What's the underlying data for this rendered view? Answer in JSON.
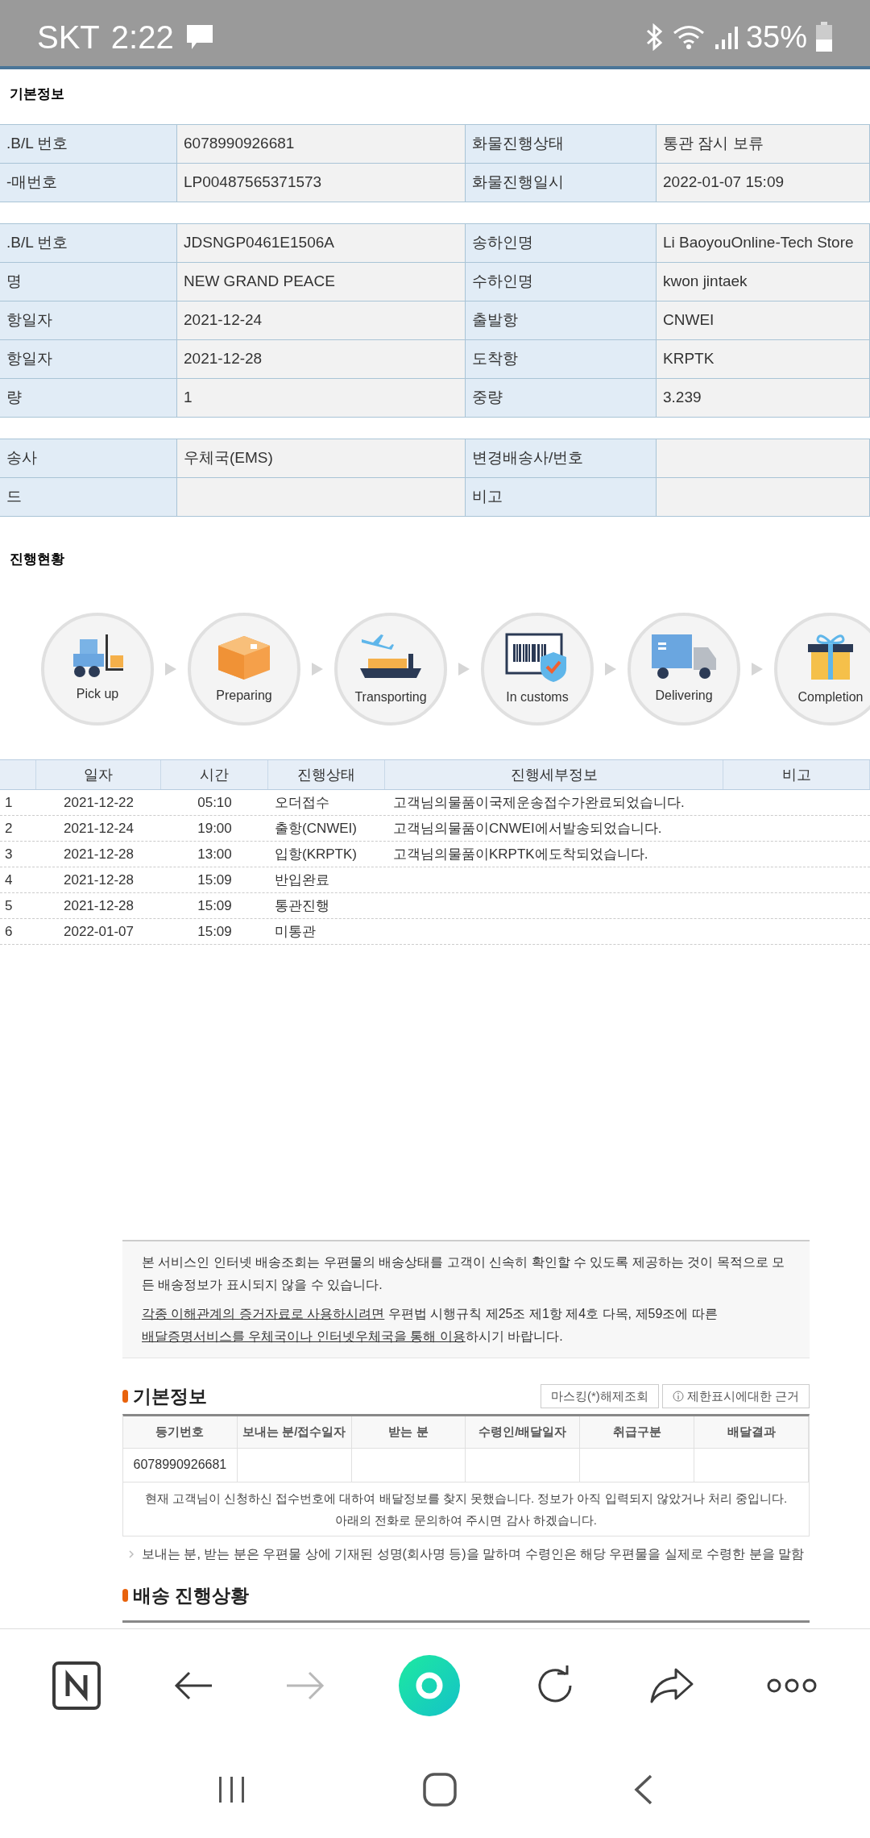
{
  "status_bar": {
    "carrier": "SKT",
    "time": "2:22",
    "battery": "35%"
  },
  "basic_info": {
    "title": "기본정보",
    "groups": [
      [
        {
          "label_1": ".B/L 번호",
          "value_1": "6078990926681",
          "label_2": "화물진행상태",
          "value_2": "통관 잠시 보류"
        },
        {
          "label_1": "-매번호",
          "value_1": "LP00487565371573",
          "label_2": "화물진행일시",
          "value_2": "2022-01-07 15:09"
        }
      ],
      [
        {
          "label_1": ".B/L 번호",
          "value_1": "JDSNGP0461E1506A",
          "label_2": "송하인명",
          "value_2": "Li BaoyouOnline-Tech Store"
        },
        {
          "label_1": "명",
          "value_1": "NEW GRAND PEACE",
          "label_2": "수하인명",
          "value_2": "kwon jintaek"
        },
        {
          "label_1": "항일자",
          "value_1": "2021-12-24",
          "label_2": "출발항",
          "value_2": "CNWEI"
        },
        {
          "label_1": "항일자",
          "value_1": "2021-12-28",
          "label_2": "도착항",
          "value_2": "KRPTK"
        },
        {
          "label_1": "량",
          "value_1": "1",
          "label_2": "중량",
          "value_2": "3.239"
        }
      ],
      [
        {
          "label_1": "송사",
          "value_1": "우체국(EMS)",
          "label_2": "변경배송사/번호"
        },
        {
          "label_1": "드",
          "label_2": "비고"
        }
      ]
    ]
  },
  "progress": {
    "title": "진행현황",
    "steps": [
      {
        "kind": "pickup",
        "label": "Pick up"
      },
      {
        "kind": "preparing",
        "label": "Preparing"
      },
      {
        "kind": "transporting",
        "label": "Transporting"
      },
      {
        "kind": "customs",
        "label": "In customs"
      },
      {
        "kind": "delivering",
        "label": "Delivering"
      },
      {
        "kind": "completion",
        "label": "Completion"
      }
    ]
  },
  "history": {
    "columns": [
      "일자",
      "시간",
      "진행상태",
      "진행세부정보",
      "비고"
    ],
    "rows": [
      {
        "no": "1",
        "date": "2021-12-22",
        "time": "05:10",
        "status": "오더접수",
        "detail": "고객님의물품이국제운송접수가완료되었습니다."
      },
      {
        "no": "2",
        "date": "2021-12-24",
        "time": "19:00",
        "status": "출항(CNWEI)",
        "detail": "고객님의물품이CNWEI에서발송되었습니다."
      },
      {
        "no": "3",
        "date": "2021-12-28",
        "time": "13:00",
        "status": "입항(KRPTK)",
        "detail": "고객님의물품이KRPTK에도착되었습니다."
      },
      {
        "no": "4",
        "date": "2021-12-28",
        "time": "15:09",
        "status": "반입완료"
      },
      {
        "no": "5",
        "date": "2021-12-28",
        "time": "15:09",
        "status": "통관진행"
      },
      {
        "no": "6",
        "date": "2022-01-07",
        "time": "15:09",
        "status": "미통관"
      }
    ]
  },
  "notice": {
    "paragraphs": [
      [
        {
          "text": "본 서비스인 인터넷 배송조회는 우편물의 배송상태를 고객이 신속히 확인할 수 있도록 제공하는 것이 목적으로 모든 배송정보가 표시되지 않을 수 있습니다.",
          "link": false
        }
      ],
      [
        {
          "text": "각종 이해관계의 증거자료로 사용하시려면",
          "link": true
        },
        {
          "text": " 우편법 시행규칙 제25조 제1항 제4호 다목, 제59조에 따른 ",
          "link": false
        },
        {
          "text": "배달증명서비스를 우체국이나 인터넷우체국을 통해 이용",
          "link": true
        },
        {
          "text": "하시기 바랍니다.",
          "link": false
        }
      ]
    ]
  },
  "postal_info": {
    "title": "기본정보",
    "buttons": [
      {
        "kind": "plain",
        "label": "마스킹(*)해제조회"
      },
      {
        "kind": "info",
        "label": "제한표시에대한 근거"
      }
    ],
    "columns": [
      "등기번호",
      "보내는 분/접수일자",
      "받는 분",
      "수령인/배달일자",
      "취급구분",
      "배달결과"
    ],
    "number": "6078990926681",
    "message": "현재 고객님이 신청하신 접수번호에 대하여 배달정보를 찾지 못했습니다. 정보가 아직 입력되지 않았거나 처리 중입니다. 아래의 전화로 문의하여 주시면 감사 하겠습니다.",
    "note": "보내는 분, 받는 분은 우편물 상에 기재된 성명(회사명 등)을 말하며 수령인은 해당 우편물을 실제로 수령한 분을 말함"
  },
  "delivery_progress": {
    "title": "배송 진행상황"
  },
  "browser_bar": {
    "buttons": [
      {
        "kind": "home",
        "disabled": false
      },
      {
        "kind": "back",
        "disabled": false
      },
      {
        "kind": "forward",
        "disabled": true
      },
      {
        "kind": "green",
        "disabled": false
      },
      {
        "kind": "refresh",
        "disabled": false
      },
      {
        "kind": "share",
        "disabled": false
      },
      {
        "kind": "more",
        "disabled": false
      }
    ]
  }
}
